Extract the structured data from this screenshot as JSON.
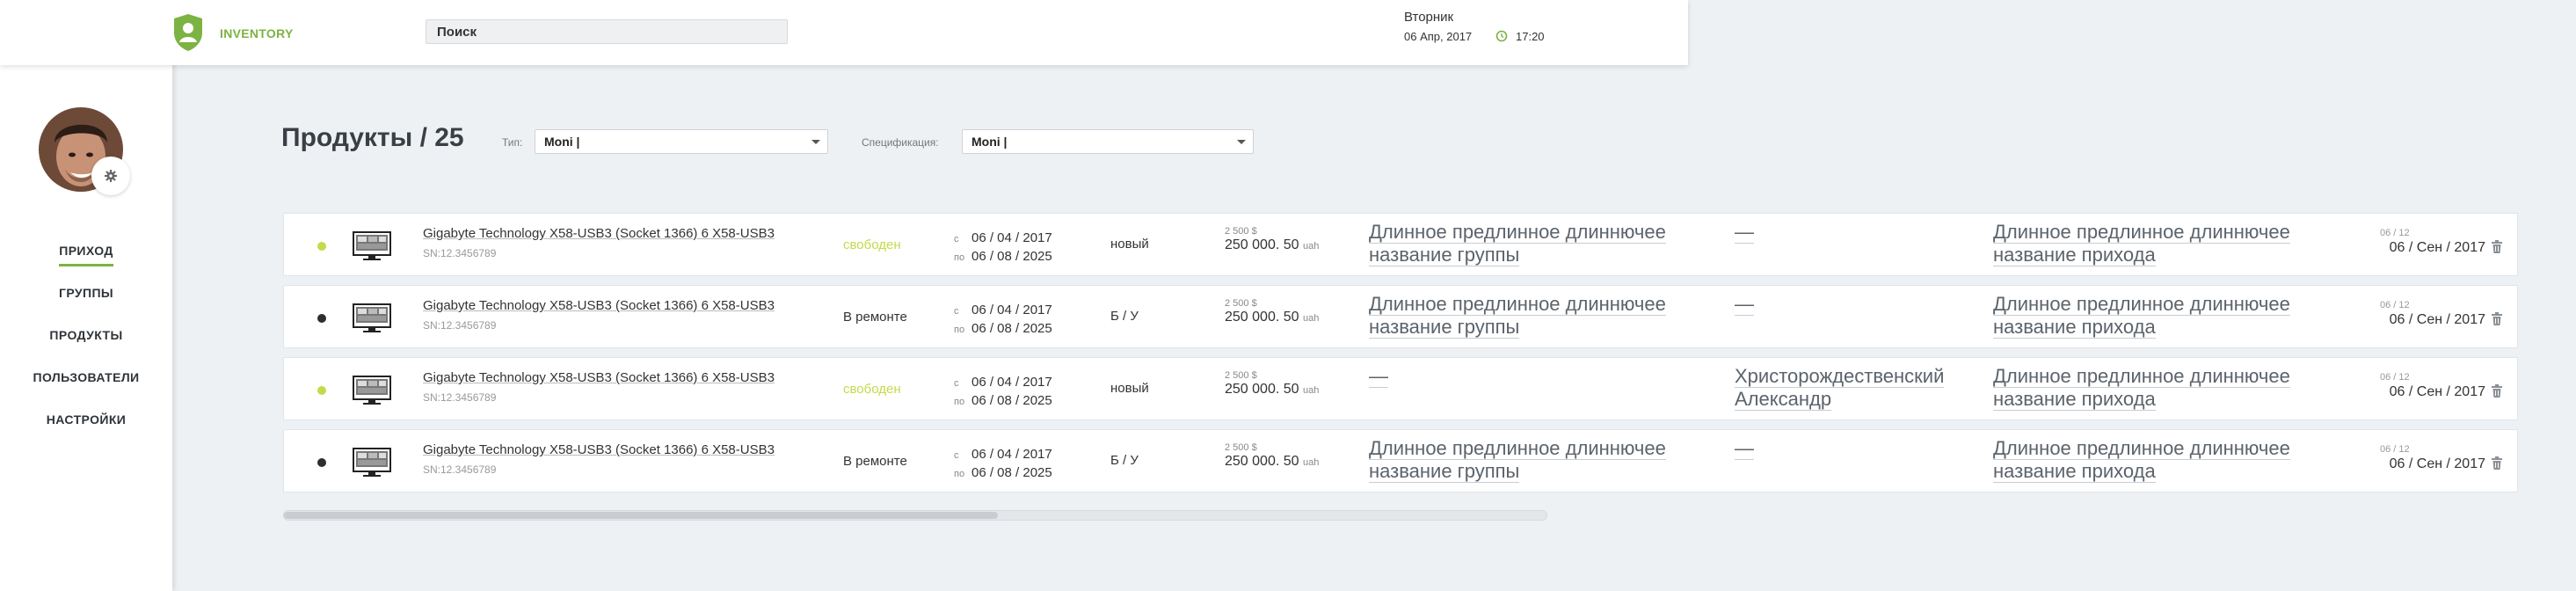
{
  "header": {
    "logo_text": "INVENTORY",
    "search_placeholder": "Поиск",
    "day": "Вторник",
    "date": "06 Апр, 2017",
    "time": "17:20",
    "accent": "#7cb342"
  },
  "sidebar": {
    "items": [
      {
        "label": "ПРИХОД",
        "active": true
      },
      {
        "label": "ГРУППЫ",
        "active": false
      },
      {
        "label": "ПРОДУКТЫ",
        "active": false
      },
      {
        "label": "ПОЛЬЗОВАТЕЛИ",
        "active": false
      },
      {
        "label": "НАСТРОЙКИ",
        "active": false
      }
    ]
  },
  "toolbar": {
    "title": "Продукты / 25",
    "type_label": "Тип:",
    "type_value": "Moni |",
    "spec_label": "Спецификация:",
    "spec_value": "Moni |"
  },
  "rows": [
    {
      "status_color": "#c6d94a",
      "name": "Gigabyte Technology X58-USB3 (Socket 1366) 6 X58-USB3",
      "sn": "SN:12.3456789",
      "status": "свободен",
      "status_text_color": "#c6d94a",
      "from_label": "с",
      "from": "06 / 04 / 2017",
      "to_label": "по",
      "to": "06 / 08 / 2025",
      "condition": "новый",
      "price_small": "2 500 $",
      "price": "250 000. 50",
      "currency": "uah",
      "group_line1": "Длинное предлинное  длиннючее",
      "group_line2": "название группы",
      "user": "—",
      "user_line2": "",
      "receipt_line1": "Длинное предлинное  длиннючее",
      "receipt_line2": "название прихода",
      "rdate_small": "06 / 12",
      "rdate": "06 / Сен  / 2017"
    },
    {
      "status_color": "#2b2f33",
      "name": "Gigabyte Technology X58-USB3 (Socket 1366) 6 X58-USB3",
      "sn": "SN:12.3456789",
      "status": "В ремонте",
      "status_text_color": "#333333",
      "from_label": "с",
      "from": "06 / 04 / 2017",
      "to_label": "по",
      "to": "06 / 08 / 2025",
      "condition": "Б / У",
      "price_small": "2 500 $",
      "price": "250 000. 50",
      "currency": "uah",
      "group_line1": "Длинное предлинное  длиннючее",
      "group_line2": "название группы",
      "user": "—",
      "user_line2": "",
      "receipt_line1": "Длинное предлинное  длиннючее",
      "receipt_line2": "название прихода",
      "rdate_small": "06 / 12",
      "rdate": "06 / Сен  / 2017"
    },
    {
      "status_color": "#c6d94a",
      "name": "Gigabyte Technology X58-USB3 (Socket 1366) 6 X58-USB3",
      "sn": "SN:12.3456789",
      "status": "свободен",
      "status_text_color": "#c6d94a",
      "from_label": "с",
      "from": "06 / 04 / 2017",
      "to_label": "по",
      "to": "06 / 08 / 2025",
      "condition": "новый",
      "price_small": "2 500 $",
      "price": "250 000. 50",
      "currency": "uah",
      "group_line1": "—",
      "group_line2": "",
      "user": "Христорождественский",
      "user_line2": "Александр",
      "receipt_line1": "Длинное предлинное  длиннючее",
      "receipt_line2": "название прихода",
      "rdate_small": "06 / 12",
      "rdate": "06 / Сен  / 2017"
    },
    {
      "status_color": "#2b2f33",
      "name": "Gigabyte Technology X58-USB3 (Socket 1366) 6 X58-USB3",
      "sn": "SN:12.3456789",
      "status": "В ремонте",
      "status_text_color": "#333333",
      "from_label": "с",
      "from": "06 / 04 / 2017",
      "to_label": "по",
      "to": "06 / 08 / 2025",
      "condition": "Б / У",
      "price_small": "2 500 $",
      "price": "250 000. 50",
      "currency": "uah",
      "group_line1": "Длинное предлинное  длиннючее",
      "group_line2": "название группы",
      "user": "—",
      "user_line2": "",
      "receipt_line1": "Длинное предлинное  длиннючее",
      "receipt_line2": "название прихода",
      "rdate_small": "06 / 12",
      "rdate": "06 / Сен  / 2017"
    }
  ]
}
